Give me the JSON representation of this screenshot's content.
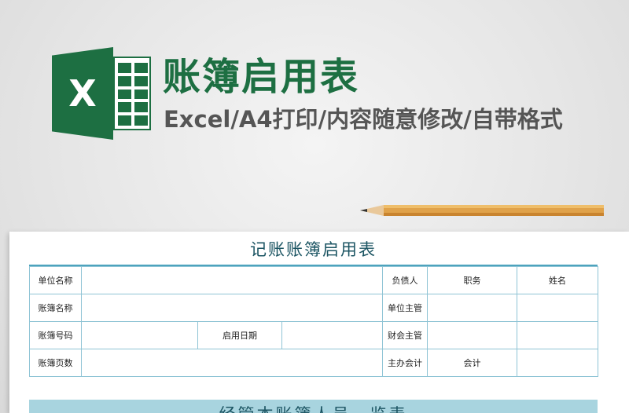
{
  "banner": {
    "logo_letter": "X",
    "title": "账簿启用表",
    "subtitle": "Excel/A4打印/内容随意修改/自带格式",
    "brand_color": "#1d6f42"
  },
  "form": {
    "title": "记账账簿启用表",
    "rows": [
      {
        "c1": "单位名称",
        "c5": "负债人",
        "c6": "职务",
        "c7": "姓名"
      },
      {
        "c1": "账簿名称",
        "c5": "单位主管"
      },
      {
        "c1": "账簿号码",
        "c3": "启用日期",
        "c5": "财会主管"
      },
      {
        "c1": "账簿页数",
        "c5": "主办会计",
        "c6": "会计"
      }
    ],
    "next_section_title": "经管本账簿人员一览表",
    "accent_color": "#4da3bd"
  }
}
